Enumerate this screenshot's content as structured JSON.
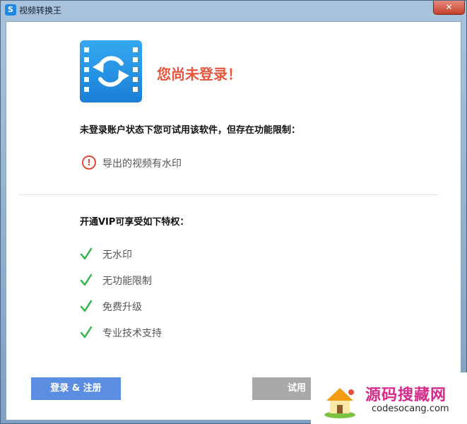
{
  "window": {
    "title": "视频转换王",
    "app_icon_glyph": "S",
    "close_glyph": "✕"
  },
  "dialog": {
    "heading": "您尚未登录！",
    "restriction_intro": "未登录账户状态下您可试用该软件，但存在功能限制：",
    "restriction_icon_glyph": "!",
    "restriction_text": "导出的视频有水印",
    "vip_intro": "开通VIP可享受如下特权：",
    "benefits": [
      {
        "label": "无水印"
      },
      {
        "label": "无功能限制"
      },
      {
        "label": "免费升级"
      },
      {
        "label": "专业技术支持"
      }
    ]
  },
  "buttons": {
    "login": "登录 & 注册",
    "trial": "试用"
  },
  "watermark": {
    "title": "源码搜藏网",
    "url": "codesocang.com"
  },
  "colors": {
    "heading": "#e8553d",
    "warning": "#e24a3a",
    "check": "#2fb344",
    "login_button": "#5b8ee0",
    "trial_button": "#a9a9a9",
    "open_button": "#24b24a",
    "logo_blue": "#1a7fd6",
    "watermark_title": "#d62a8a"
  },
  "icons": {
    "app": "app-logo-icon",
    "close": "close-icon",
    "logo": "video-convert-icon",
    "warning": "warning-circle-icon",
    "check": "check-icon",
    "watermark": "house-icon"
  }
}
